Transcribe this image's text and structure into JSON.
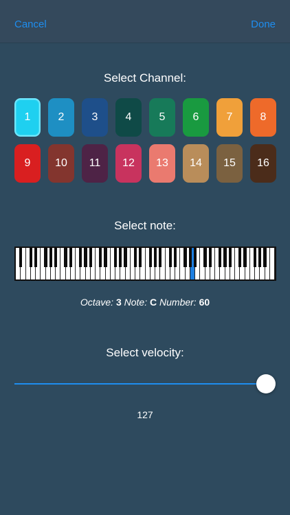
{
  "navbar": {
    "cancel_label": "Cancel",
    "done_label": "Done"
  },
  "channel": {
    "title": "Select Channel:",
    "selected": 1,
    "items": [
      {
        "label": "1",
        "color": "#1fd0f0"
      },
      {
        "label": "2",
        "color": "#1e8fc3"
      },
      {
        "label": "3",
        "color": "#1e4f8a"
      },
      {
        "label": "4",
        "color": "#0f4a47"
      },
      {
        "label": "5",
        "color": "#177a59"
      },
      {
        "label": "6",
        "color": "#199a40"
      },
      {
        "label": "7",
        "color": "#f0a03a"
      },
      {
        "label": "8",
        "color": "#ee6a2a"
      },
      {
        "label": "9",
        "color": "#d91f20"
      },
      {
        "label": "10",
        "color": "#83352e"
      },
      {
        "label": "11",
        "color": "#4e2346"
      },
      {
        "label": "12",
        "color": "#c8335e"
      },
      {
        "label": "13",
        "color": "#ea7a6f"
      },
      {
        "label": "14",
        "color": "#b98d5a"
      },
      {
        "label": "15",
        "color": "#7b6140"
      },
      {
        "label": "16",
        "color": "#4b2c1a"
      }
    ]
  },
  "note": {
    "title": "Select note:",
    "octave_label": "Octave:",
    "octave_value": "3",
    "note_label": "Note:",
    "note_value": "C",
    "number_label": "Number:",
    "number_value": "60",
    "selected_white_key_index": 35,
    "white_key_count": 52
  },
  "velocity": {
    "title": "Select velocity:",
    "value": "127",
    "fraction": 1.0
  },
  "colors": {
    "accent": "#1e8ef0",
    "background": "#2e4a5e",
    "selected_key": "#1e7fe0"
  }
}
